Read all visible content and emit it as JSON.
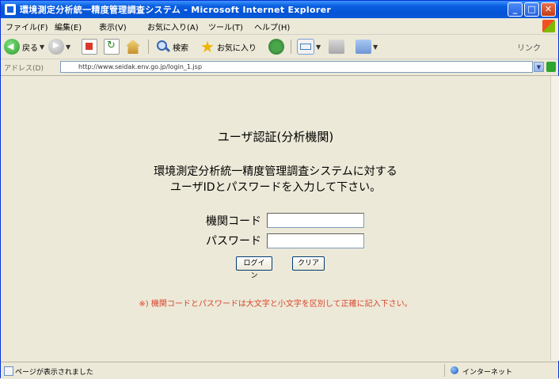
{
  "window": {
    "title": "環境測定分析統一精度管理調査システム - Microsoft Internet Explorer"
  },
  "menu": [
    "ファイル(F)",
    "編集(E)",
    "表示(V)",
    "お気に入り(A)",
    "ツール(T)",
    "ヘルプ(H)"
  ],
  "toolbar": {
    "back_label": "戻る",
    "search_label": "検索",
    "favorites_label": "お気に入り",
    "links_label": "リンク"
  },
  "address": {
    "label": "アドレス(D)",
    "url": "http://www.seidak.env.go.jp/login_1.jsp",
    "go_label": "移動"
  },
  "page": {
    "heading": "ユーザ認証(分析機関)",
    "intro_line1": "環境測定分析統一精度管理調査システムに対する",
    "intro_line2": "ユーザIDとパスワードを入力して下さい。",
    "org_code_label": "機関コード",
    "org_code_value": "",
    "password_label": "パスワード",
    "password_value": "",
    "login_button": "ログイン",
    "clear_button": "クリア",
    "note": "※) 機関コードとパスワードは大文字と小文字を区別して正確に記入下さい。",
    "note_color": "#d8442a"
  },
  "status": {
    "text": "ページが表示されました",
    "zone": "インターネット"
  }
}
